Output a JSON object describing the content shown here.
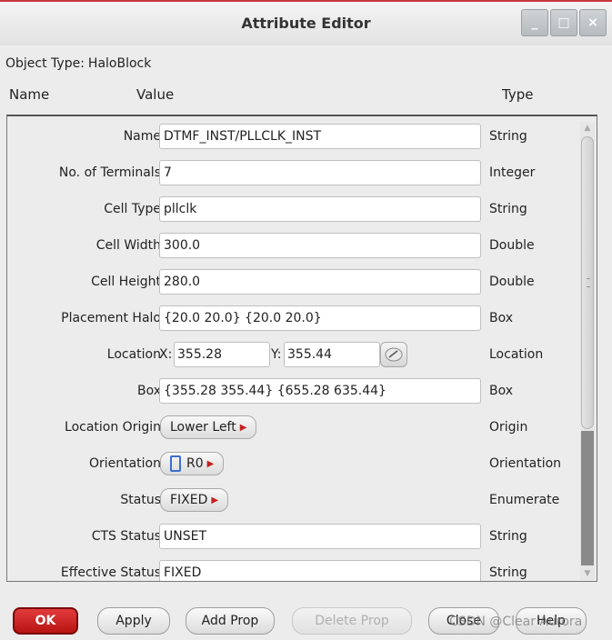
{
  "window": {
    "title": "Attribute Editor",
    "buttons": {
      "minimize": "_",
      "maximize": "□",
      "close": "×"
    }
  },
  "object_type": {
    "label": "Object Type:",
    "value": "HaloBlock"
  },
  "columns": {
    "name": "Name",
    "value": "Value",
    "type": "Type"
  },
  "rows": [
    {
      "label": "Name",
      "value": "DTMF_INST/PLLCLK_INST",
      "type": "String"
    },
    {
      "label": "No. of Terminals",
      "value": "7",
      "type": "Integer"
    },
    {
      "label": "Cell Type",
      "value": "pllclk",
      "type": "String"
    },
    {
      "label": "Cell Width",
      "value": "300.0",
      "type": "Double"
    },
    {
      "label": "Cell Height",
      "value": "280.0",
      "type": "Double"
    },
    {
      "label": "Placement Halo",
      "value": "{20.0 20.0} {20.0 20.0}",
      "type": "Box"
    },
    {
      "label": "Location",
      "x_label": "X:",
      "x_value": "355.28",
      "y_label": "Y:",
      "y_value": "355.44",
      "type": "Location"
    },
    {
      "label": "Box",
      "value": "{355.28 355.44} {655.28 635.44}",
      "type": "Box"
    },
    {
      "label": "Location Origin",
      "value": "Lower Left",
      "type": "Origin"
    },
    {
      "label": "Orientation",
      "value": "R0",
      "type": "Orientation"
    },
    {
      "label": "Status",
      "value": "FIXED",
      "type": "Enumerate"
    },
    {
      "label": "CTS Status",
      "value": "UNSET",
      "type": "String"
    },
    {
      "label": "Effective Status",
      "value": "FIXED",
      "type": "String"
    }
  ],
  "buttons": {
    "ok": "OK",
    "apply": "Apply",
    "add_prop": "Add Prop",
    "delete_prop": "Delete Prop",
    "close": "Close",
    "help": "Help"
  },
  "watermark": "CSDN @Clear Aurora",
  "colors": {
    "ok_button": "#c81e1e",
    "window_accent": "#c83a3a",
    "arrow": "#c62020"
  }
}
